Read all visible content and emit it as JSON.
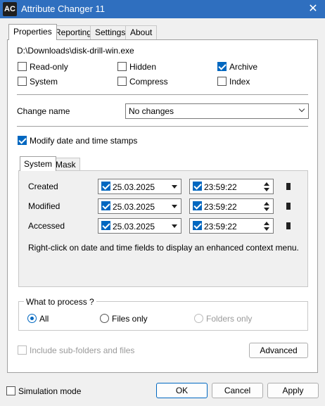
{
  "window": {
    "title": "Attribute Changer 11",
    "icon_text": "AC"
  },
  "tabs": [
    "Properties",
    "Reporting",
    "Settings",
    "About"
  ],
  "properties": {
    "path": "D:\\Downloads\\disk-drill-win.exe",
    "attributes": [
      {
        "label": "Read-only",
        "checked": false
      },
      {
        "label": "Hidden",
        "checked": false
      },
      {
        "label": "Archive",
        "checked": true
      },
      {
        "label": "System",
        "checked": false
      },
      {
        "label": "Compress",
        "checked": false
      },
      {
        "label": "Index",
        "checked": false
      }
    ],
    "change_name_label": "Change name",
    "change_name_value": "No changes",
    "modify_dates_label": "Modify date and time stamps",
    "modify_dates_checked": true,
    "subtabs": [
      "System",
      "Mask"
    ],
    "date_rows": [
      {
        "label": "Created",
        "date": "25.03.2025",
        "time": "23:59:22"
      },
      {
        "label": "Modified",
        "date": "25.03.2025",
        "time": "23:59:22"
      },
      {
        "label": "Accessed",
        "date": "25.03.2025",
        "time": "23:59:22"
      }
    ],
    "hint": "Right-click on date and time fields to display an enhanced context menu.",
    "process": {
      "title": "What to process ?",
      "options": [
        {
          "label": "All",
          "selected": true
        },
        {
          "label": "Files only",
          "selected": false
        },
        {
          "label": "Folders only",
          "selected": false,
          "disabled": true
        }
      ]
    },
    "include_subfolders_label": "Include sub-folders and files",
    "advanced_label": "Advanced"
  },
  "footer": {
    "simulation_label": "Simulation mode",
    "ok_label": "OK",
    "cancel_label": "Cancel",
    "apply_label": "Apply"
  },
  "colors": {
    "accent": "#0067c0",
    "titlebar": "#2f6fbf"
  }
}
